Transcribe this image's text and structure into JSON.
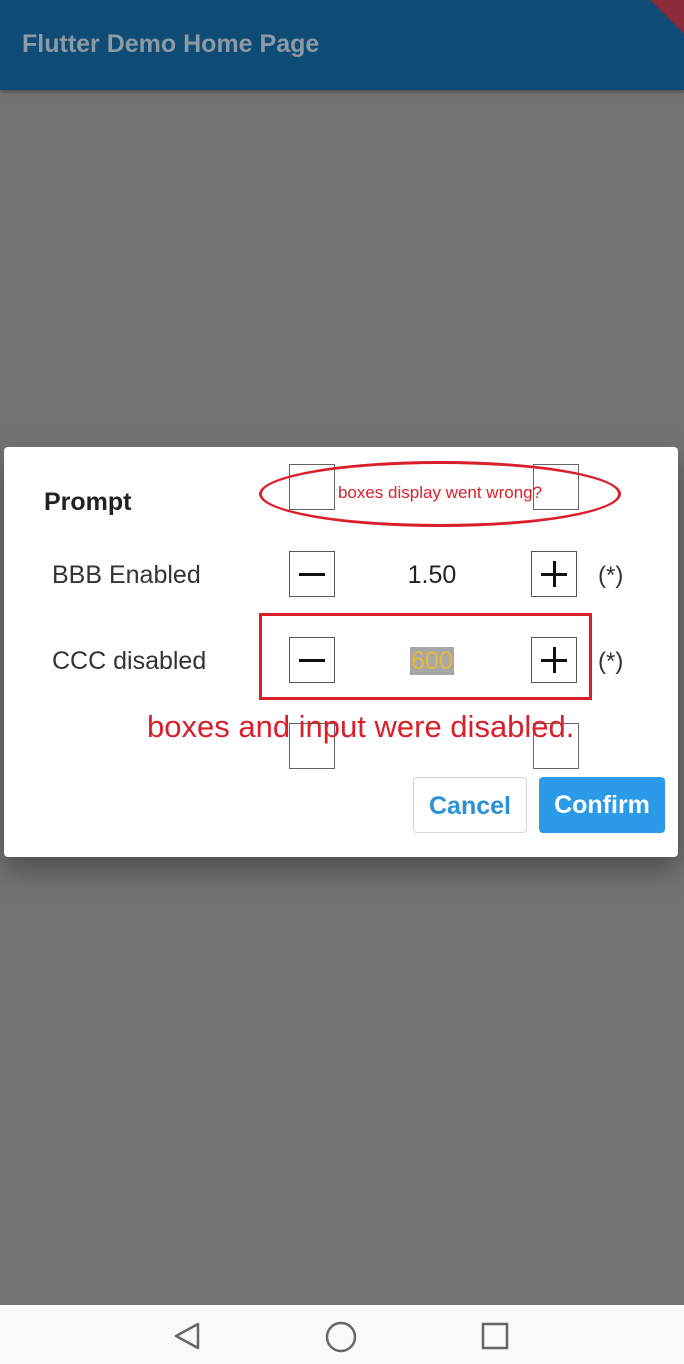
{
  "appbar": {
    "title": "Flutter Demo Home Page"
  },
  "dialog": {
    "title": "Prompt",
    "rows": [
      {
        "label": "BBB Enabled",
        "value": "1.50",
        "suffix": "(*)"
      },
      {
        "label": "CCC disabled",
        "value": "600",
        "suffix": "(*)"
      }
    ],
    "buttons": {
      "cancel": "Cancel",
      "confirm": "Confirm"
    }
  },
  "annotations": {
    "ellipse_note": "boxes display went wrong?",
    "rect_note": "boxes and input were disabled."
  },
  "navigation": {
    "icons": [
      "back-icon",
      "home-icon",
      "recents-icon"
    ]
  }
}
